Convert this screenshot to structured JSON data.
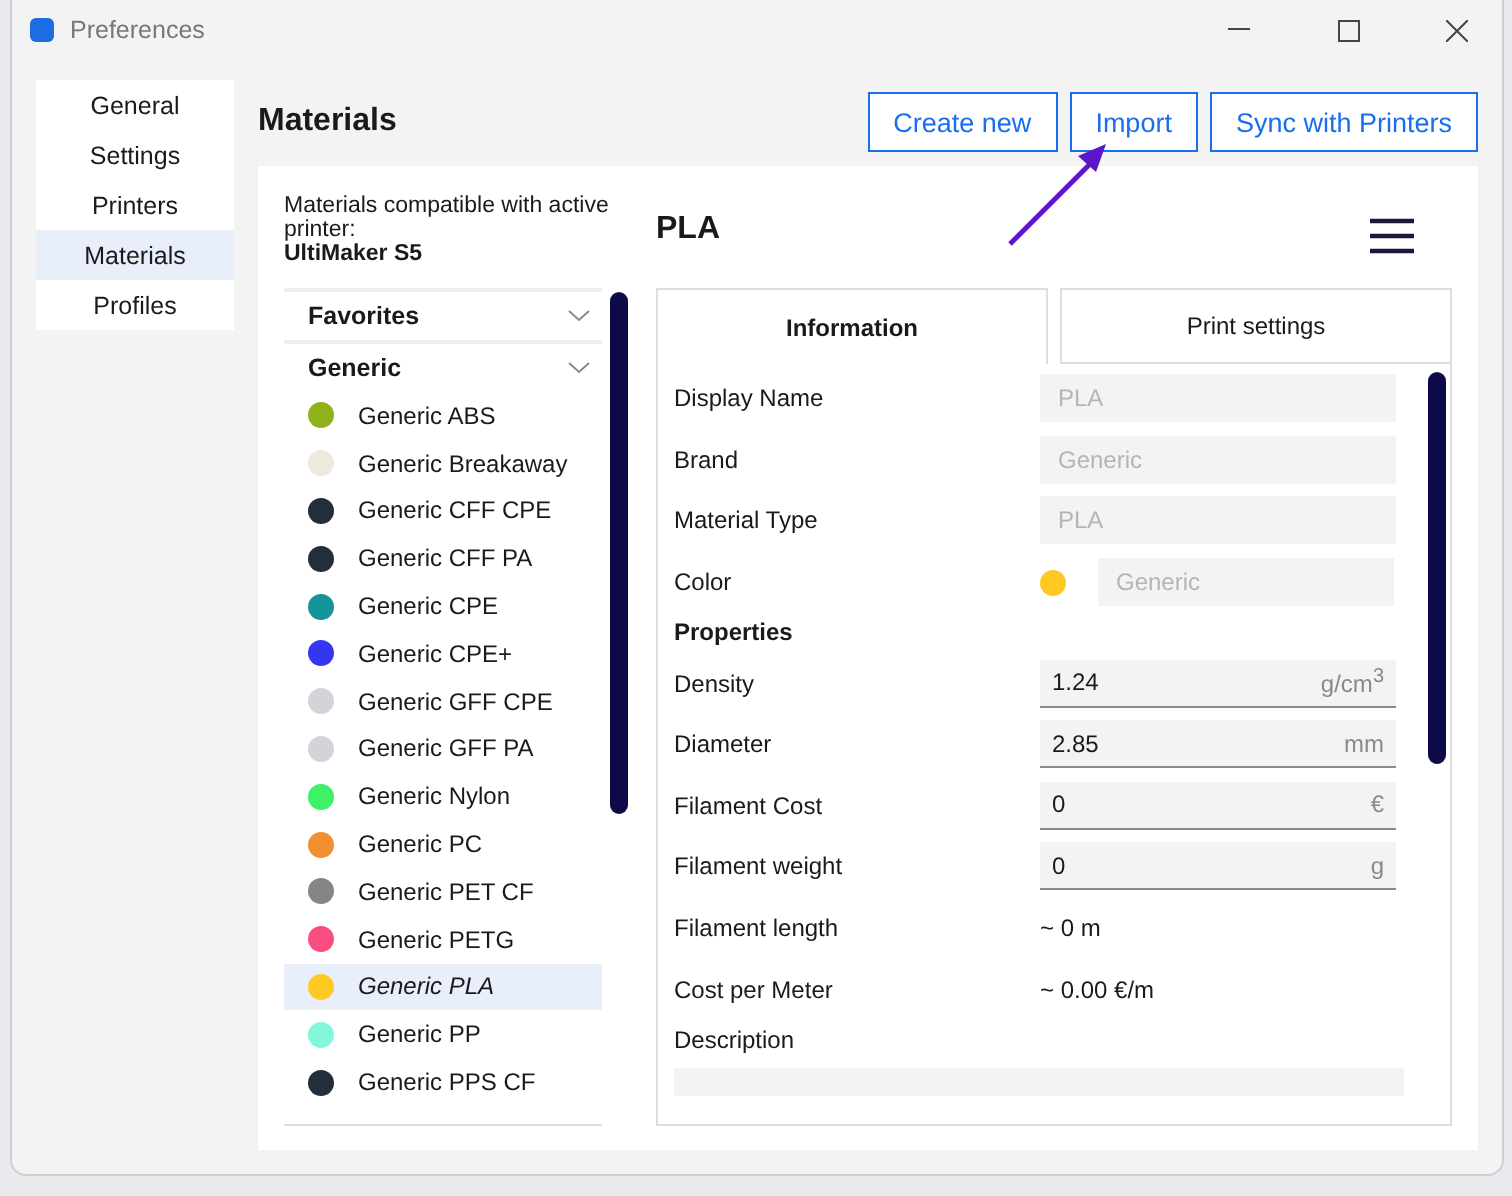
{
  "window": {
    "title": "Preferences"
  },
  "sidebar": {
    "items": [
      {
        "label": "General",
        "selected": false
      },
      {
        "label": "Settings",
        "selected": false
      },
      {
        "label": "Printers",
        "selected": false
      },
      {
        "label": "Materials",
        "selected": true
      },
      {
        "label": "Profiles",
        "selected": false
      }
    ]
  },
  "page": {
    "title": "Materials",
    "buttons": [
      "Create new",
      "Import",
      "Sync with Printers"
    ]
  },
  "compatibility": {
    "label": "Materials compatible with active printer:",
    "printer": "UltiMaker S5"
  },
  "material_title": "PLA",
  "groups": [
    {
      "label": "Favorites"
    },
    {
      "label": "Generic",
      "items": [
        {
          "name": "Generic ABS",
          "color": "#8fb21a",
          "selected": false
        },
        {
          "name": "Generic Breakaway",
          "color": "#ede9df",
          "selected": false
        },
        {
          "name": "Generic CFF CPE",
          "color": "#232e3a",
          "selected": false
        },
        {
          "name": "Generic CFF PA",
          "color": "#232e3a",
          "selected": false
        },
        {
          "name": "Generic CPE",
          "color": "#159499",
          "selected": false
        },
        {
          "name": "Generic CPE+",
          "color": "#3436f0",
          "selected": false
        },
        {
          "name": "Generic GFF CPE",
          "color": "#d2d4d9",
          "selected": false
        },
        {
          "name": "Generic GFF PA",
          "color": "#d2d4d9",
          "selected": false
        },
        {
          "name": "Generic Nylon",
          "color": "#3df266",
          "selected": false
        },
        {
          "name": "Generic PC",
          "color": "#f29030",
          "selected": false
        },
        {
          "name": "Generic PET CF",
          "color": "#858585",
          "selected": false
        },
        {
          "name": "Generic PETG",
          "color": "#f94e80",
          "selected": false
        },
        {
          "name": "Generic PLA",
          "color": "#ffc924",
          "selected": true
        },
        {
          "name": "Generic PP",
          "color": "#84f7db",
          "selected": false
        },
        {
          "name": "Generic PPS CF",
          "color": "#232e3a",
          "selected": false
        }
      ]
    }
  ],
  "tabs": [
    {
      "label": "Information",
      "selected": true
    },
    {
      "label": "Print settings",
      "selected": false
    }
  ],
  "fields": [
    {
      "kind": "readonly",
      "label": "Display Name",
      "value": "PLA",
      "disabled": true
    },
    {
      "kind": "readonly",
      "label": "Brand",
      "value": "Generic",
      "disabled": true
    },
    {
      "kind": "readonly",
      "label": "Material Type",
      "value": "PLA",
      "disabled": true
    },
    {
      "kind": "color",
      "label": "Color",
      "value": "Generic",
      "color": "#ffc924",
      "disabled": true
    },
    {
      "kind": "heading",
      "label": "Properties"
    },
    {
      "kind": "input",
      "label": "Density",
      "value": "1.24",
      "unit": "g/cm$^{3}$"
    },
    {
      "kind": "input",
      "label": "Diameter",
      "value": "2.85",
      "unit": "mm"
    },
    {
      "kind": "input",
      "label": "Filament Cost",
      "value": "0",
      "unit": "€"
    },
    {
      "kind": "input",
      "label": "Filament weight",
      "value": "0",
      "unit": "g"
    },
    {
      "kind": "text",
      "label": "Filament length",
      "value": "~ 0 m"
    },
    {
      "kind": "text",
      "label": "Cost per Meter",
      "value": "~ 0.00 €/m"
    },
    {
      "kind": "description",
      "label": "Description"
    }
  ]
}
